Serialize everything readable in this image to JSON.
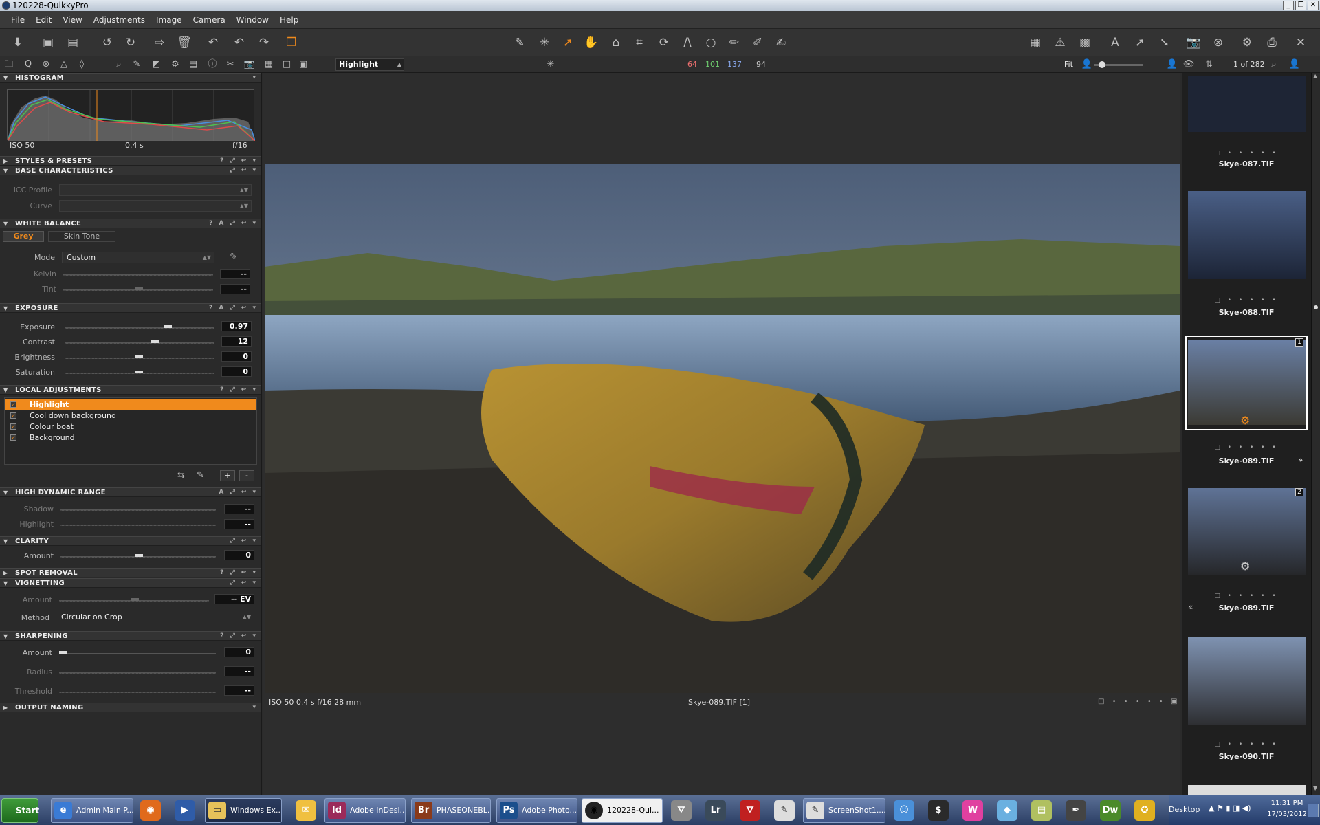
{
  "window": {
    "title": "120228-QuikkyPro"
  },
  "menu": [
    "File",
    "Edit",
    "View",
    "Adjustments",
    "Image",
    "Camera",
    "Window",
    "Help"
  ],
  "toolbar2": {
    "cursor_tool_value": "Highlight",
    "rgb_r": "64",
    "rgb_g": "101",
    "rgb_b": "137",
    "rgb_l": "94",
    "fit_label": "Fit",
    "counter": "1 of 282"
  },
  "histogram": {
    "section_title": "HISTOGRAM",
    "iso": "ISO 50",
    "shutter": "0.4 s",
    "aperture": "f/16"
  },
  "styles": {
    "section_title": "STYLES & PRESETS"
  },
  "base": {
    "section_title": "BASE CHARACTERISTICS",
    "icc_label": "ICC Profile",
    "curve_label": "Curve"
  },
  "white_balance": {
    "section_title": "WHITE BALANCE",
    "tab_grey": "Grey",
    "tab_skin": "Skin Tone",
    "mode_label": "Mode",
    "mode_value": "Custom",
    "kelvin_label": "Kelvin",
    "kelvin_value": "--",
    "tint_label": "Tint",
    "tint_value": "--"
  },
  "exposure": {
    "section_title": "EXPOSURE",
    "exposure_label": "Exposure",
    "exposure_value": "0.97",
    "contrast_label": "Contrast",
    "contrast_value": "12",
    "brightness_label": "Brightness",
    "brightness_value": "0",
    "saturation_label": "Saturation",
    "saturation_value": "0"
  },
  "local_adjustments": {
    "section_title": "LOCAL ADJUSTMENTS",
    "layers": [
      "Highlight",
      "Cool down background",
      "Colour boat",
      "Background"
    ],
    "add_btn": "+",
    "remove_btn": "-"
  },
  "hdr": {
    "section_title": "HIGH DYNAMIC RANGE",
    "shadow_label": "Shadow",
    "shadow_value": "--",
    "highlight_label": "Highlight",
    "highlight_value": "--"
  },
  "clarity": {
    "section_title": "CLARITY",
    "amount_label": "Amount",
    "amount_value": "0"
  },
  "spot": {
    "section_title": "SPOT REMOVAL"
  },
  "vignetting": {
    "section_title": "VIGNETTING",
    "amount_label": "Amount",
    "amount_value": "-- EV",
    "method_label": "Method",
    "method_value": "Circular on Crop"
  },
  "sharpening": {
    "section_title": "SHARPENING",
    "amount_label": "Amount",
    "amount_value": "0",
    "radius_label": "Radius",
    "radius_value": "--",
    "threshold_label": "Threshold",
    "threshold_value": "--"
  },
  "output": {
    "section_title": "OUTPUT NAMING"
  },
  "viewer": {
    "status_left": "ISO 50  0.4 s  f/16  28 mm",
    "status_center": "Skye-089.TIF [1]"
  },
  "browser": {
    "thumbs": [
      "Skye-087.TIF",
      "Skye-088.TIF",
      "Skye-089.TIF",
      "Skye-089.TIF",
      "Skye-090.TIF"
    ],
    "badge_1": "1",
    "badge_2": "2"
  },
  "taskbar": {
    "start": "Start",
    "buttons": [
      "Admin Main P...",
      "Windows Ex...",
      "Adobe InDesi...",
      "PHASEONEBL...",
      "Adobe Photo...",
      "120228-Qui...",
      "ScreenShot1...."
    ],
    "desktop": "Desktop",
    "time": "11:31 PM",
    "date": "17/03/2012"
  },
  "colors": {
    "accent": "#f08a1c",
    "panel": "#2a2a2a",
    "header": "#333333"
  }
}
